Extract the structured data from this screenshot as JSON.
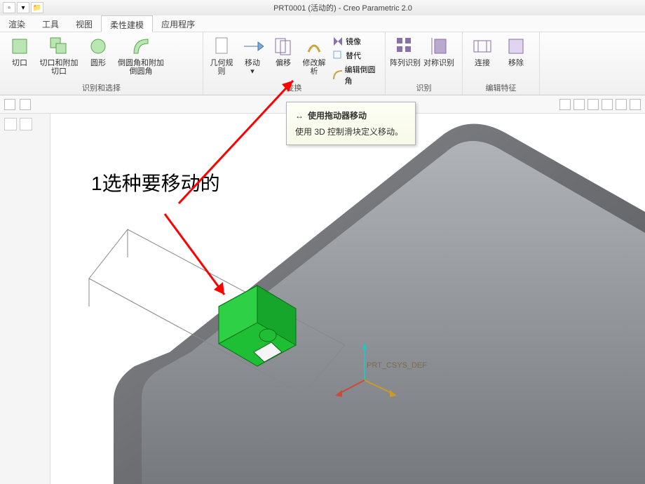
{
  "titlebar": {
    "title": "PRT0001 (活动的) - Creo Parametric 2.0"
  },
  "tabs": [
    "渲染",
    "工具",
    "视图",
    "柔性建模",
    "应用程序"
  ],
  "active_tab_index": 3,
  "ribbon": {
    "group1": {
      "label": "识别和选择",
      "buttons": [
        "切口",
        "切口和附加切口",
        "圆形",
        "倒圆角和附加倒圆角"
      ]
    },
    "group2": {
      "label": "变换",
      "rule": "几何规则",
      "move": "移动",
      "offset": "偏移",
      "modify": "修改解析",
      "small": [
        "镜像",
        "替代",
        "编辑倒圆角"
      ]
    },
    "group3": {
      "label": "识别",
      "buttons": [
        "阵列识别",
        "对称识别"
      ]
    },
    "group4": {
      "label": "编辑特征",
      "buttons": [
        "连接",
        "移除"
      ]
    }
  },
  "tooltip": {
    "title": "使用拖动器移动",
    "body": "使用 3D 控制滑块定义移动。"
  },
  "annotation": "1选种要移动的",
  "csys": "PRT_CSYS_DEF"
}
